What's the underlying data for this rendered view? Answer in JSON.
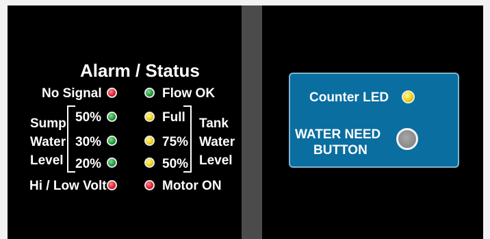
{
  "alarm_panel": {
    "title": "Alarm / Status",
    "no_signal": "No Signal",
    "flow_ok": "Flow OK",
    "sump_group": {
      "line1": "Sump",
      "line2": "Water",
      "line3": "Level"
    },
    "sump_levels": [
      "50%",
      "30%",
      "20%"
    ],
    "tank_levels": [
      "Full",
      "75%",
      "50%"
    ],
    "tank_group": {
      "line1": "Tank",
      "line2": "Water",
      "line3": "Level"
    },
    "hi_low_volt": "Hi / Low Volt",
    "motor_on": "Motor ON"
  },
  "leds": {
    "no_signal": "red-led",
    "flow_ok": "green-led",
    "sump_50": "green-led",
    "sump_30": "green-led",
    "sump_20": "green-led",
    "tank_full": "yellow-led",
    "tank_75": "yellow-led",
    "tank_50": "yellow-led",
    "hi_low_volt": "red-led",
    "motor_on": "red-led",
    "counter": "yellow-led"
  },
  "control_card": {
    "counter_led_label": "Counter LED",
    "water_need_line1": "WATER NEED",
    "water_need_line2": "BUTTON"
  },
  "colors": {
    "background": "#000000",
    "divider": "#4b4b4b",
    "card": "#0a6ea0",
    "red": "#e21d2e",
    "green": "#1f9a3a",
    "yellow": "#f2d10b",
    "button_gray": "#8f8f8f"
  }
}
